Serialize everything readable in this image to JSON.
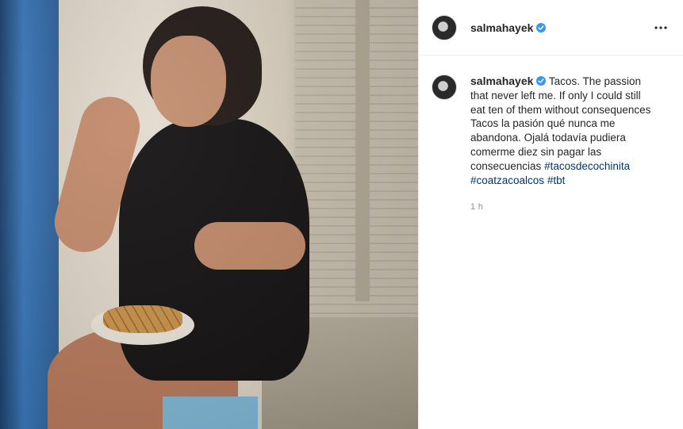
{
  "post": {
    "author": {
      "username": "salmahayek",
      "verified": true,
      "avatar": "profile-photo"
    },
    "header": {
      "username": "salmahayek",
      "more_icon": "more-horizontal-icon"
    },
    "caption": {
      "username": "salmahayek",
      "text_main": "Tacos. The passion that never left me. If only I could still eat ten of them without consequences Tacos la pasión qué nunca me abandona. Ojalá todavía pudiera comerme diez sin pagar las consecuencias",
      "hashtags": [
        "#tacosdecochinita",
        "#coatzacoalcos",
        "#tbt"
      ]
    },
    "timestamp": "1 h",
    "media": {
      "type": "photo"
    }
  },
  "colors": {
    "verified_badge": "#3897f0",
    "hashtag": "#00376b",
    "secondary_text": "#8e8e8e"
  }
}
